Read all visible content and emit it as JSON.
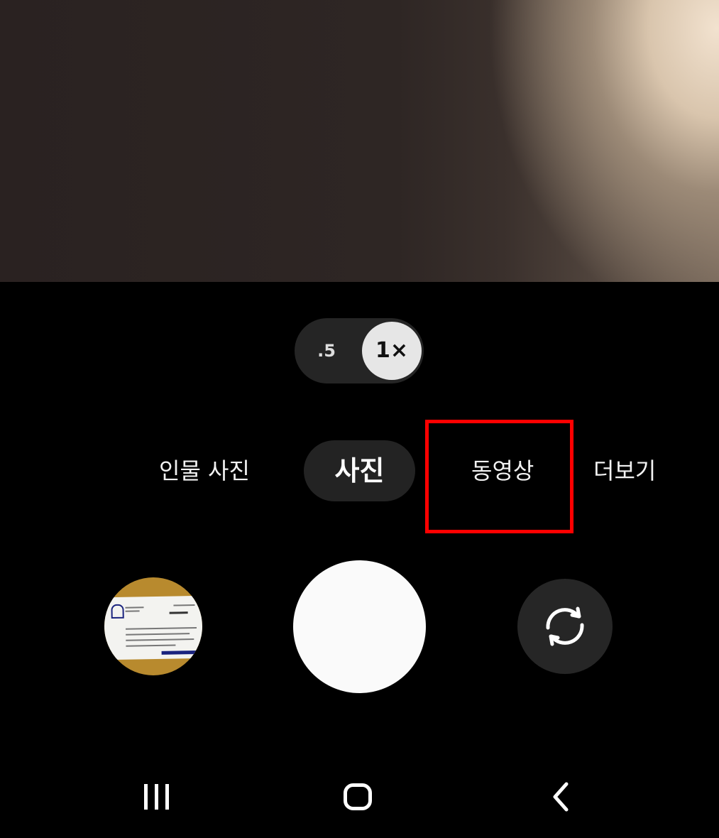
{
  "zoom": {
    "wide_label": ".5",
    "selected_label": "1×"
  },
  "modes": {
    "portrait": "인물 사진",
    "photo": "사진",
    "video": "동영상",
    "more": "더보기",
    "selected": "사진",
    "highlighted": "동영상"
  },
  "colors": {
    "highlight": "#ff0000",
    "shutter": "#fafafa",
    "control_bg": "#262626"
  },
  "icons": {
    "switch_camera": "rotate-cycle-icon",
    "nav_recent": "recent-apps-icon",
    "nav_home": "home-icon",
    "nav_back": "back-chevron-icon"
  }
}
